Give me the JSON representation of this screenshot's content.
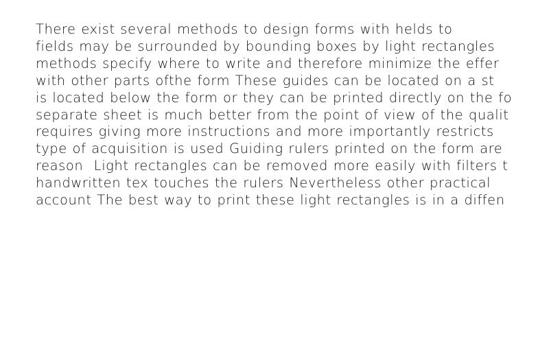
{
  "document": {
    "lines": [
      "There exist several methods to design forms with helds to",
      "fields may be surrounded by bounding boxes by light rectangles",
      "methods specify where to write and therefore minimize the effer",
      "with other parts ofthe form These guides can be located on a st",
      "is located below the form or they can be printed directly on the fo",
      "separate sheet is much better from the point of view of the qualit",
      "requires giving more instructions and more importantly restricts",
      "type of acquisition is used Guiding rulers printed on the form are",
      "reason  Light rectangles can be removed more easily with filters t",
      "handwritten tex touches the rulers Nevertheless other practical",
      "account The best way to print these light rectangles is in a diffen"
    ]
  }
}
